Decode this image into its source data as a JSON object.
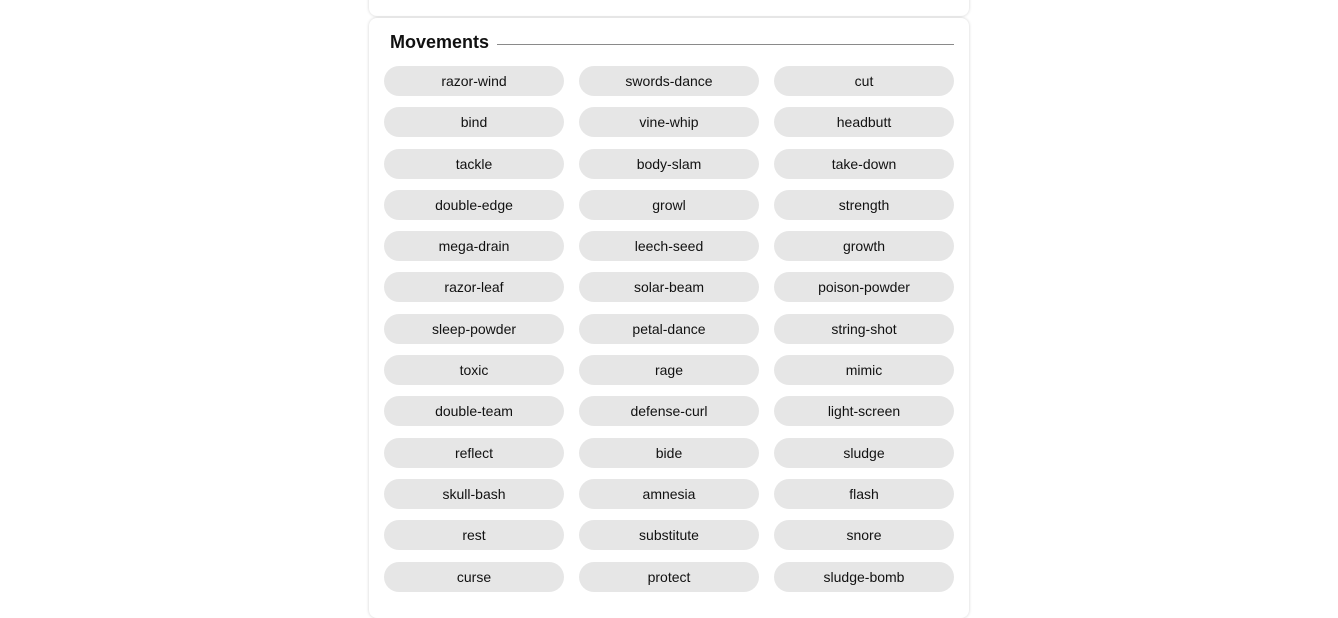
{
  "section": {
    "title": "Movements"
  },
  "moves": [
    "razor-wind",
    "swords-dance",
    "cut",
    "bind",
    "vine-whip",
    "headbutt",
    "tackle",
    "body-slam",
    "take-down",
    "double-edge",
    "growl",
    "strength",
    "mega-drain",
    "leech-seed",
    "growth",
    "razor-leaf",
    "solar-beam",
    "poison-powder",
    "sleep-powder",
    "petal-dance",
    "string-shot",
    "toxic",
    "rage",
    "mimic",
    "double-team",
    "defense-curl",
    "light-screen",
    "reflect",
    "bide",
    "sludge",
    "skull-bash",
    "amnesia",
    "flash",
    "rest",
    "substitute",
    "snore",
    "curse",
    "protect",
    "sludge-bomb"
  ],
  "colors": {
    "pill_background": "#e6e6e6",
    "rule": "#8a8a8a"
  }
}
